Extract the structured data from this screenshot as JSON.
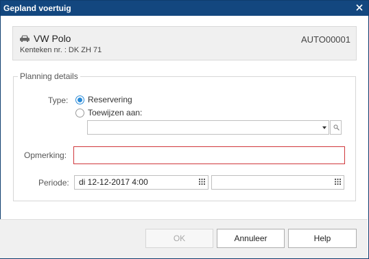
{
  "window": {
    "title": "Gepland voertuig"
  },
  "vehicle": {
    "name": "VW Polo",
    "kenteken": "Kenteken nr. : DK ZH 71",
    "code": "AUTO00001"
  },
  "planning": {
    "legend": "Planning details",
    "type_label": "Type:",
    "option_reservation": "Reservering",
    "option_assign": "Toewijzen aan:",
    "selected_option": "Reservering",
    "assign_value": "",
    "remark_label": "Opmerking:",
    "remark_value": "",
    "period_label": "Periode:",
    "period_start": "di 12-12-2017 4:00",
    "period_end": ""
  },
  "buttons": {
    "ok": "OK",
    "cancel": "Annuleer",
    "help": "Help"
  },
  "colors": {
    "titlebar": "#13477f",
    "accent": "#2a8bd8",
    "error_border": "#d0363a"
  }
}
